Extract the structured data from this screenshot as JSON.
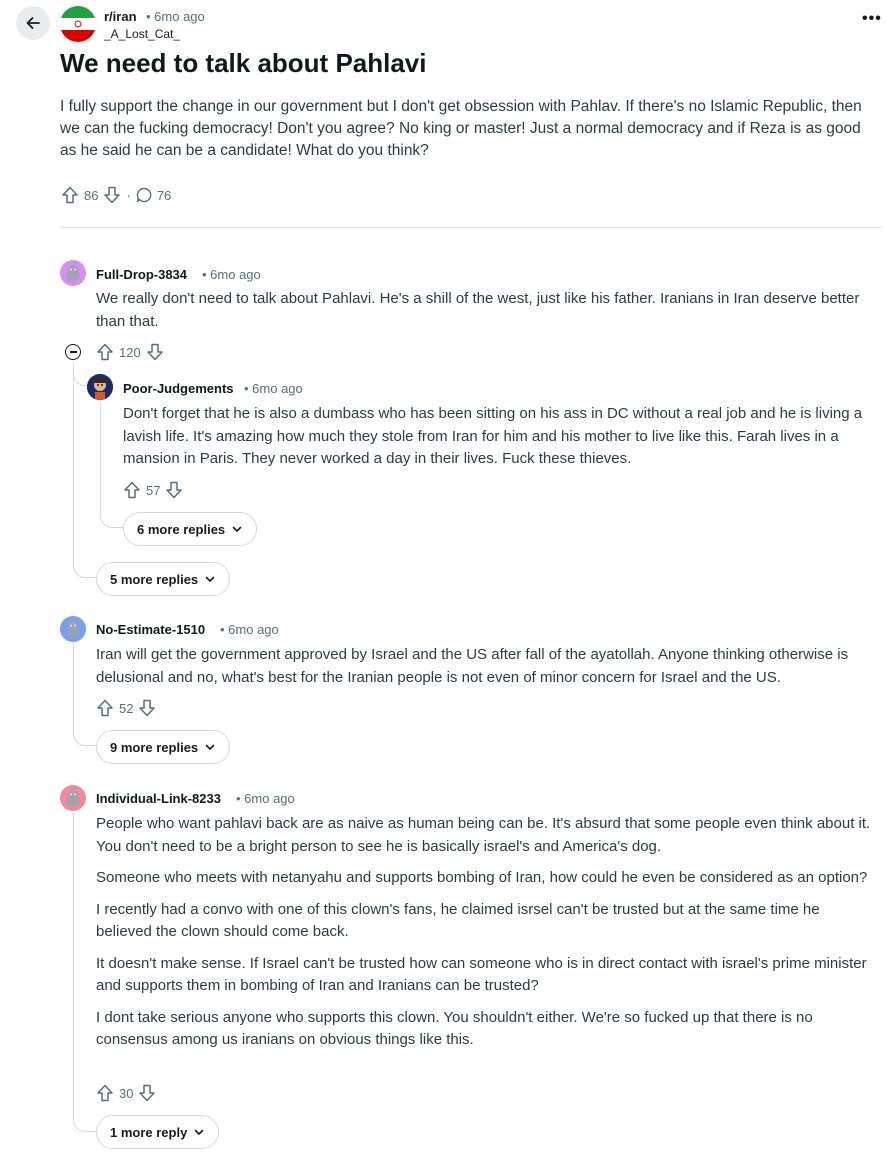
{
  "header": {
    "subreddit": "r/iran",
    "time": "• 6mo ago",
    "author": "_A_Lost_Cat_",
    "more": "•••"
  },
  "post": {
    "title": "We need to talk about Pahlavi",
    "body": "I fully support the change in our government but I don't get obsession with Pahlav. If there's no Islamic Republic, then we can the fucking democracy! Don't you agree? No king or master! Just a normal democracy and if Reza is as good as he said he can be a candidate! What do you think?",
    "votes": "86",
    "separator": "·",
    "comments": "76"
  },
  "comments": [
    {
      "author": "Full-Drop-3834",
      "time": "• 6mo ago",
      "avatar_color": "#d98ef0",
      "body": [
        "We really don't need to talk about Pahlavi. He's a shill of the west, just like his father. Iranians in Iran deserve better than that."
      ],
      "votes": "120",
      "more_replies": "5 more replies",
      "reply": {
        "author": "Poor-Judgements",
        "time": "• 6mo ago",
        "body": [
          "Don't forget that he is also a dumbass who has been sitting on his ass in DC without a real job and he is living a lavish life. It's amazing how much they stole from Iran for him and his mother to live like this. Farah lives in a mansion in Paris. They never worked a day in their lives. Fuck these thieves."
        ],
        "votes": "57",
        "more_replies": "6 more replies"
      }
    },
    {
      "author": "No-Estimate-1510",
      "time": "• 6mo ago",
      "avatar_color": "#7a9ef0",
      "body": [
        "Iran will get the government approved by Israel and the US after fall of the ayatollah. Anyone thinking otherwise is delusional and no, what's best for the Iranian people is not even of minor concern for Israel and the US."
      ],
      "votes": "52",
      "more_replies": "9 more replies"
    },
    {
      "author": "Individual-Link-8233",
      "time": "• 6mo ago",
      "avatar_color": "#f08a9a",
      "body": [
        "People who want pahlavi back are as naive as human being can be. It's absurd that some people even think about it. You don't need to be a bright person to see he is basically israel's and America's dog.",
        "Someone who meets with netanyahu and supports bombing of Iran, how could he even be considered as an option?",
        "I recently had a convo with one of this clown's fans, he claimed isrsel can't be trusted but at the same time he believed the clown should come back.",
        "It doesn't make sense. If Israel can't be trusted how can someone who is in direct contact with israel's prime minister and supports them in bombing of Iran and Iranians can be trusted?",
        "I dont take serious anyone who supports this clown. You shouldn't either. We're so fucked up that there is no consensus among us iranians on obvious things like this."
      ],
      "votes": "30",
      "more_replies": "1 more reply"
    }
  ]
}
